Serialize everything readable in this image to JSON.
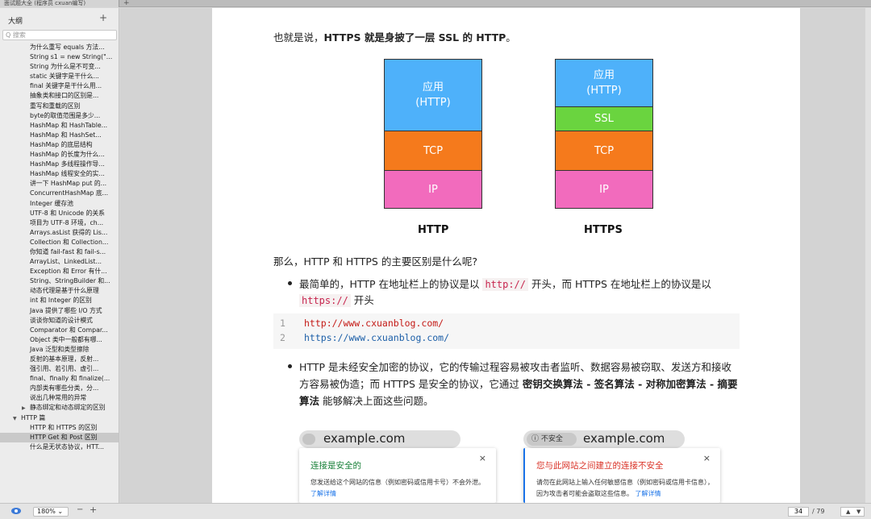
{
  "tab": {
    "title": "面试题大全 (程序员 cxuan编写)",
    "add": "+"
  },
  "sidebar": {
    "title": "大纲",
    "add": "+",
    "search_placeholder": "Q 搜索",
    "items": [
      "为什么重写 equals 方法...",
      "String s1 = new String(\"...",
      "String 为什么是不可变...",
      "static 关键字是干什么...",
      "final 关键字是干什么用...",
      "抽象类和接口的区别是...",
      "重写和重载的区别",
      "byte的取值范围是多少...",
      "HashMap 和 HashTable...",
      "HashMap 和 HashSet...",
      "HashMap 的底层结构",
      "HashMap 的长度为什么...",
      "HashMap 多线程操作导...",
      "HashMap 线程安全的实...",
      "讲一下 HashMap put 的...",
      "ConcurrentHashMap 底...",
      "Integer 缓存池",
      "UTF-8 和 Unicode 的关系",
      "项目为 UTF-8 环境，ch...",
      "Arrays.asList 获得的 Lis...",
      "Collection 和 Collection...",
      "你知道 fail-fast 和 fail-s...",
      "ArrayList、LinkedList...",
      "Exception 和 Error 有什...",
      "String、StringBuilder 和...",
      "动态代理是基于什么原理",
      "int 和 Integer 的区别",
      "Java 提供了哪些 I/O 方式",
      "谈谈你知道的设计模式",
      "Comparator 和 Compar...",
      "Object 类中一般都有哪...",
      "Java 泛型和类型擦除",
      "反射的基本原理，反射...",
      "强引用、若引用、虚引...",
      "final、finally 和 finalize(...",
      "内部类有哪些分类，分...",
      "说出几种常用的异常",
      "静态绑定和动态绑定的区别",
      "HTTP 篇",
      "HTTP 和 HTTPS 的区别",
      "HTTP Get 和 Post 区别",
      "什么是无状态协议，HTT..."
    ]
  },
  "page": {
    "intro_pre": "也就是说，",
    "intro_bold": "HTTPS 就是身披了一层 SSL 的 HTTP",
    "intro_post": "。",
    "diagram": {
      "http_label": "HTTP",
      "https_label": "HTTPS",
      "app_line1": "应用",
      "app_line2": "(HTTP)",
      "ssl": "SSL",
      "tcp": "TCP",
      "ip": "IP",
      "colors": {
        "app": "#4eb1fa",
        "ssl": "#6ad43f",
        "tcp": "#f57a1c",
        "ip": "#f26bbd"
      }
    },
    "question": "那么，HTTP 和 HTTPS 的主要区别是什么呢?",
    "bullet1_pre": "最简单的，HTTP 在地址栏上的协议是以 ",
    "bullet1_code1": "http://",
    "bullet1_mid": " 开头，而 HTTPS 在地址栏上的协议是以",
    "bullet1_code2": "https://",
    "bullet1_post": " 开头",
    "code": {
      "ln1": "1",
      "ln2": "2",
      "line1": "http://www.cxuanblog.com/",
      "line2": "https://www.cxuanblog.com/"
    },
    "bullet2_line1": "HTTP 是未经安全加密的协议，它的传输过程容易被攻击者监听、数据容易被窃取、发送方和接收",
    "bullet2_line2_pre": "方容易被伪造；而 HTTPS 是安全的协议，它通过 ",
    "bullet2_line2_bold": "密钥交换算法 - 签名算法 - 对称加密算法 - 摘要",
    "bullet2_line3_bold": "算法",
    "bullet2_line3_post": " 能够解决上面这些问题。",
    "secure_box": {
      "url": "example.com",
      "title": "连接是安全的",
      "body": "您发送给这个网站的信息（例如密码或信用卡号）不会外泄。",
      "link": "了解详情",
      "close": "×"
    },
    "insecure_box": {
      "badge": "ⓘ 不安全",
      "url": "example.com",
      "title": "您与此网站之间建立的连接不安全",
      "body": "请勿在此网站上输入任何敏感信息（例如密码或信用卡信息），因为攻击者可能会盗取这些信息。",
      "link": "了解详情",
      "close": "×"
    }
  },
  "status": {
    "zoom": "180% ⌄",
    "zoom_out": "−",
    "zoom_in": "+",
    "page_current": "34",
    "page_total": "/ 79",
    "prev": "▲",
    "next": "▼"
  }
}
